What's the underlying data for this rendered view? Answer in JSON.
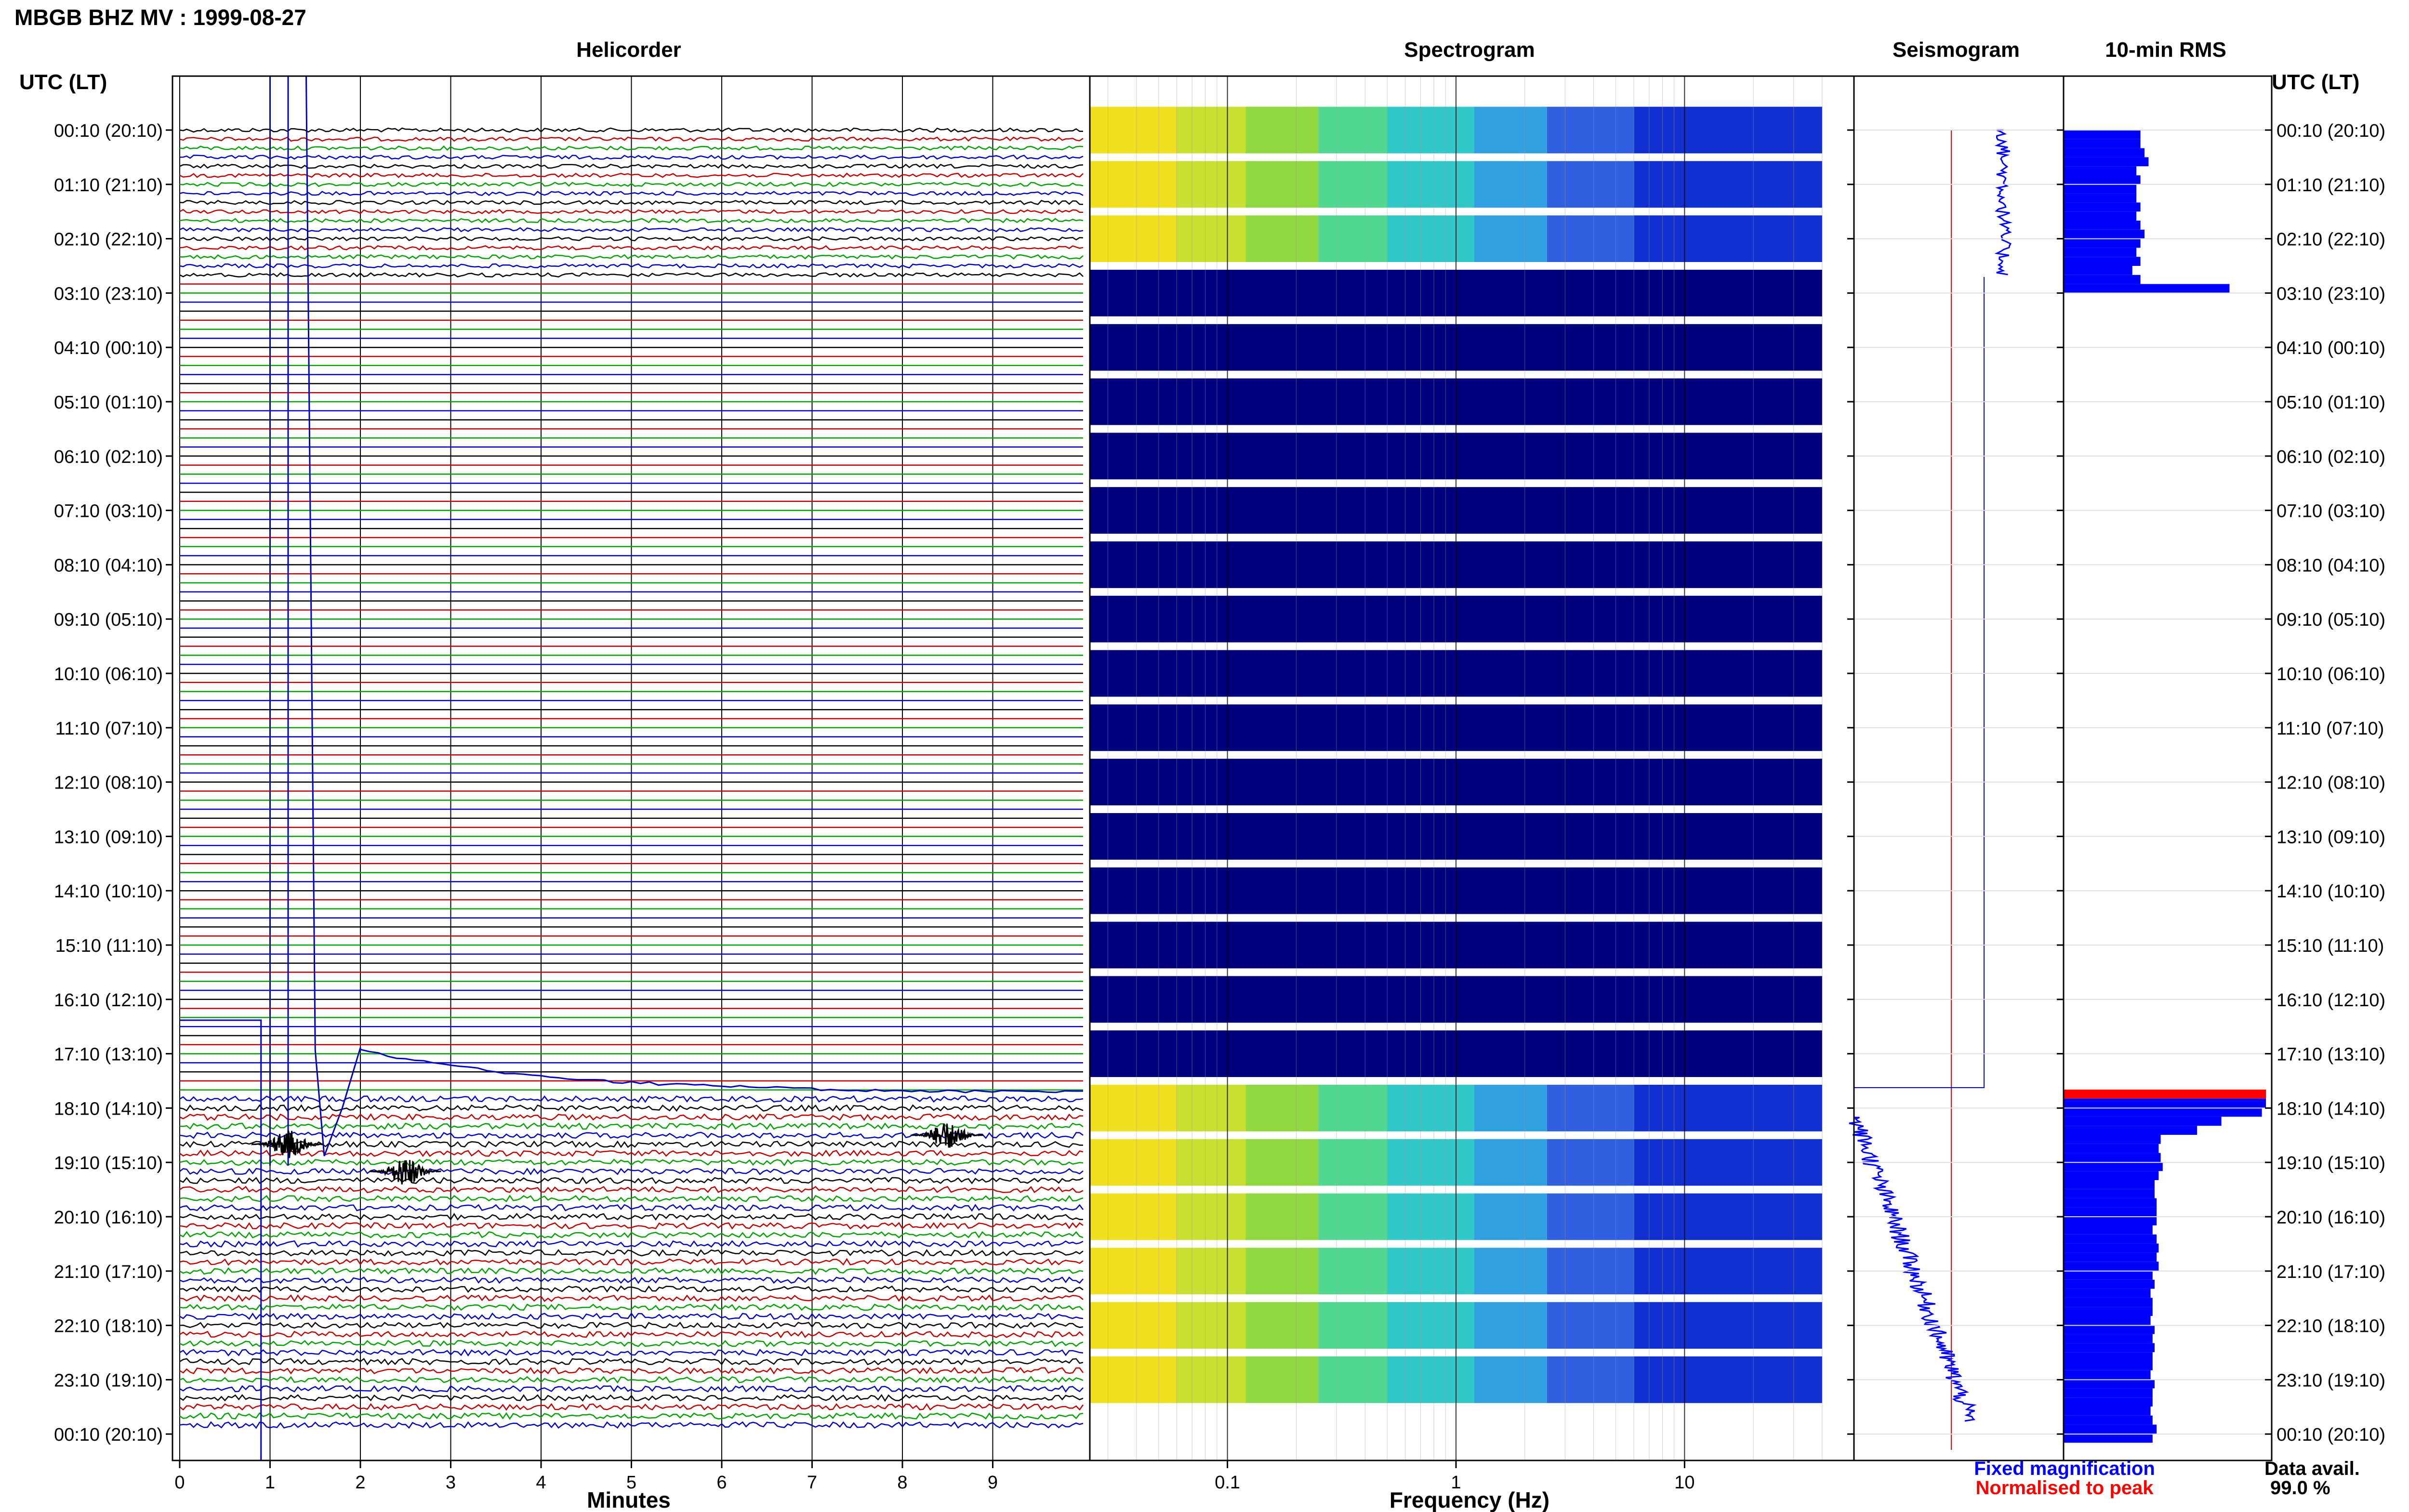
{
  "station_title": "MBGB BHZ MV : 1999-08-27",
  "panels": {
    "helicorder": "Helicorder",
    "spectrogram": "Spectrogram",
    "seismogram": "Seismogram",
    "rms": "10-min RMS"
  },
  "time_axis_label_left": "UTC (LT)",
  "time_axis_label_right": "UTC (LT)",
  "legend": {
    "fixed": "Fixed magnification",
    "normalised": "Normalised to peak",
    "fixed_color": "#0000ff",
    "normalised_color": "#ff0000"
  },
  "data_avail": {
    "label": "Data avail.",
    "value": "99.0 %"
  },
  "colors": {
    "trace_palette": [
      "#000000",
      "#c00000",
      "#00a000",
      "#0000c0"
    ],
    "spectrogram_empty": "#00007f",
    "rms_bar": "#0000ff",
    "rms_peak": "#ff0000"
  },
  "chart_data": [
    {
      "type": "line",
      "name": "helicorder",
      "xlabel": "Minutes",
      "xlim": [
        0,
        10
      ],
      "x_ticks": [
        "0",
        "1",
        "2",
        "3",
        "4",
        "5",
        "6",
        "7",
        "8",
        "9"
      ],
      "rows_per_hour": 6,
      "row_minutes": 10,
      "y_ticks": [
        "00:10 (20:10)",
        "01:10 (21:10)",
        "02:10 (22:10)",
        "03:10 (23:10)",
        "04:10 (00:10)",
        "05:10 (01:10)",
        "06:10 (02:10)",
        "07:10 (03:10)",
        "08:10 (04:10)",
        "09:10 (05:10)",
        "10:10 (06:10)",
        "11:10 (07:10)",
        "12:10 (08:10)",
        "13:10 (09:10)",
        "14:10 (10:10)",
        "15:10 (11:10)",
        "16:10 (12:10)",
        "17:10 (13:10)",
        "18:10 (14:10)",
        "19:10 (15:10)",
        "20:10 (16:10)",
        "21:10 (17:10)",
        "22:10 (18:10)",
        "23:10 (19:10)",
        "00:10 (20:10)"
      ],
      "data_gap_utc": [
        "03:00",
        "18:00"
      ],
      "events": [
        {
          "time_utc": "18:50",
          "minute": 1.2
        },
        {
          "time_utc": "19:20",
          "minute": 2.5
        },
        {
          "time_utc": "18:40",
          "minute": 8.5
        }
      ]
    },
    {
      "type": "heatmap",
      "name": "spectrogram",
      "xlabel": "Frequency (Hz)",
      "x_scale": "log",
      "xlim": [
        0.025,
        40
      ],
      "x_ticks": [
        "0.1",
        "1",
        "10"
      ],
      "data_gap_utc": [
        "03:00",
        "18:00"
      ]
    },
    {
      "type": "line",
      "name": "seismogram",
      "series_colors": [
        "#0000ff",
        "#ff0000"
      ]
    },
    {
      "type": "bar",
      "name": "10-min RMS",
      "orientation": "horizontal",
      "values_first_block": [
        0.38,
        0.38,
        0.4,
        0.42,
        0.36,
        0.38,
        0.36,
        0.36,
        0.38,
        0.36,
        0.38,
        0.4,
        0.38,
        0.36,
        0.38,
        0.34,
        0.38,
        0.82
      ],
      "values_last_block": [
        1.0,
        0.98,
        0.78,
        0.66,
        0.48,
        0.47,
        0.48,
        0.49,
        0.47,
        0.45,
        0.45,
        0.46,
        0.46,
        0.46,
        0.44,
        0.46,
        0.47,
        0.46,
        0.47,
        0.44,
        0.45,
        0.43,
        0.44,
        0.44,
        0.43,
        0.45,
        0.44,
        0.45,
        0.44,
        0.44,
        0.43,
        0.45,
        0.44,
        0.44,
        0.43,
        0.44,
        0.46,
        0.44
      ]
    }
  ]
}
